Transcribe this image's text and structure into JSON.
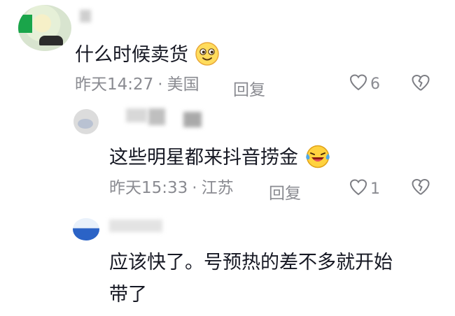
{
  "comments": [
    {
      "text": "什么时候卖货",
      "time": "昨天14:27",
      "location": "美国",
      "reply_label": "回复",
      "like_count": "6",
      "emoji": "smiling-face-icon"
    },
    {
      "text": "这些明星都来抖音捞金",
      "time": "昨天15:33",
      "location": "江苏",
      "reply_label": "回复",
      "like_count": "1",
      "emoji": "laughing-crying-face-icon"
    },
    {
      "text_line1": "应该快了。号预热的差不多就开始",
      "text_line2": "带了"
    }
  ],
  "separator": "·",
  "colors": {
    "meta": "#8a8b91",
    "text": "#161823",
    "heart_outline": "#7d7e84"
  },
  "icons": [
    "heart-outline-icon",
    "broken-heart-icon"
  ]
}
